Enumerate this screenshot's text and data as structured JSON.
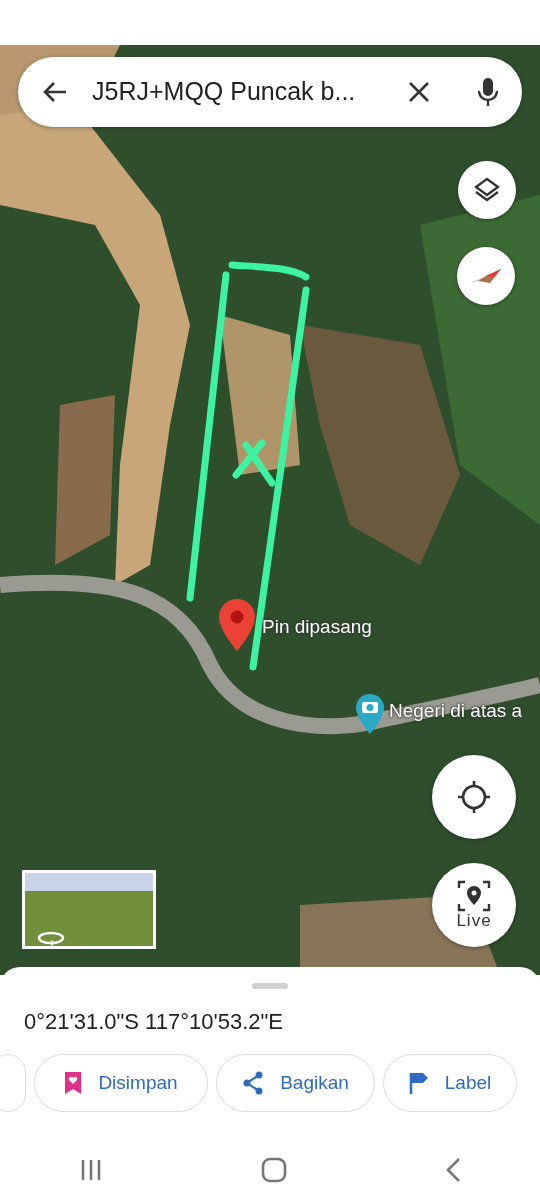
{
  "search": {
    "value": "J5RJ+MQQ Puncak b..."
  },
  "map": {
    "pins": [
      {
        "kind": "dropped",
        "label": "Pin dipasang"
      },
      {
        "kind": "photo",
        "label": "Negeri di atas a"
      }
    ],
    "buttons": [
      {
        "kind": "layers"
      },
      {
        "kind": "compass"
      },
      {
        "kind": "locate"
      },
      {
        "kind": "live",
        "label": "Live"
      }
    ]
  },
  "place_sheet": {
    "coordinates": "0°21'31.0\"S 117°10'53.2\"E",
    "actions": [
      {
        "kind": "partial"
      },
      {
        "kind": "saved",
        "label": "Disimpan"
      },
      {
        "kind": "share",
        "label": "Bagikan"
      },
      {
        "kind": "flag",
        "label": "Label"
      }
    ]
  }
}
